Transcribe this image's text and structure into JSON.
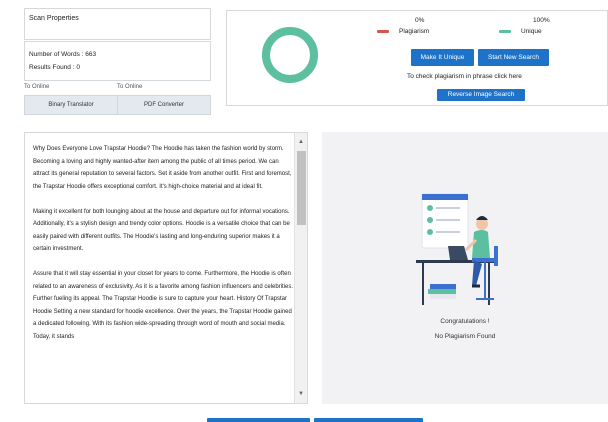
{
  "scan": {
    "title": "Scan Properties",
    "words": "Number of Words : 663",
    "results": "Results Found : 0"
  },
  "tools": {
    "label_left": "To Online",
    "label_right": "To Online",
    "binary_label": "Binary Translator",
    "pdf_label": "PDF Converter"
  },
  "result": {
    "plagiarism_pct": "0%",
    "unique_pct": "100%",
    "plagiarism_label": "Plagiarism",
    "unique_label": "Unique",
    "plagiarism_value": 0,
    "unique_value": 100,
    "plagiarism_color": "#d9534f",
    "unique_color": "#5cbf9f",
    "make_unique_label": "Make It Unique",
    "start_new_label": "Start New Search",
    "check_text": "To check plagiarism in phrase click here",
    "reverse_image_label": "Reverse Image Search"
  },
  "text": {
    "paragraphs": [
      "Why Does Everyone Love Trapstar Hoodie? The Hoodie has taken the fashion world by storm. Becoming a loving and highly wanted-after item among the public of all times period. We can attract its general reputation to several factors. Set it aside from another outfit. First and foremost, the Trapstar Hoodie offers exceptional comfort. It's high-choice material and at ideal fit.",
      "Making it excellent for both lounging about at the house and departure out for informal vocations. Additionally, it's a stylish design and trendy color options. Hoodie is a versatile choice that can be easily paired with different outfits. The Hoodie's lasting and long-enduring superior makes it a certain investment.",
      "Assure that it will stay essential in your closet for years to come. Furthermore, the Hoodie is often related to an awareness of exclusivity. As it is a favorite among fashion influencers and celebrities. Further fueling its appeal. The Trapstar Hoodie is sure to capture your heart. History Of Trapstar Hoodie Setting a new standard for hoodie excellence. Over the years, the Trapstar Hoodie gained a dedicated following. With its fashion wide-spreading through word of mouth and social media. Today, it stands"
    ]
  },
  "illustration": {
    "congrats": "Congratulations !",
    "no_plagiarism": "No Plagiarism Found"
  }
}
